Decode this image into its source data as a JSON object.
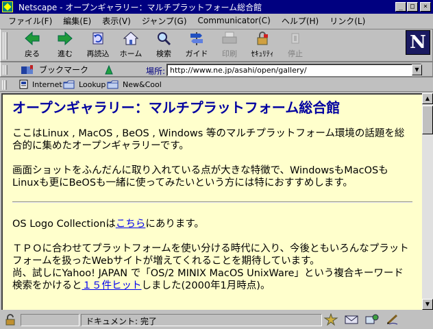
{
  "window": {
    "title": "Netscape - オープンギャラリー：マルチプラットフォーム総合館",
    "minimize": "_",
    "maximize": "□",
    "close": "×"
  },
  "menu": [
    "ファイル(F)",
    "編集(E)",
    "表示(V)",
    "ジャンプ(G)",
    "Communicator(C)",
    "ヘルプ(H)",
    "リンク(L)"
  ],
  "toolbar": {
    "buttons": [
      {
        "label": "戻る",
        "icon": "back-arrow-icon"
      },
      {
        "label": "進む",
        "icon": "forward-arrow-icon"
      },
      {
        "label": "再読込",
        "icon": "reload-icon"
      },
      {
        "label": "ホーム",
        "icon": "home-icon"
      },
      {
        "label": "検索",
        "icon": "search-icon"
      },
      {
        "label": "ガイド",
        "icon": "guide-icon"
      },
      {
        "label": "印刷",
        "icon": "print-icon",
        "disabled": true
      },
      {
        "label": "ｾｷｭﾘﾃｨ",
        "icon": "security-icon"
      },
      {
        "label": "停止",
        "icon": "stop-icon",
        "disabled": true
      }
    ],
    "logo": "N"
  },
  "location": {
    "bookmark_label": "ブックマーク",
    "label": "場所:",
    "url": "http://www.ne.jp/asahi/open/gallery/"
  },
  "personal_toolbar": [
    "Internet",
    "Lookup",
    "New&Cool"
  ],
  "page": {
    "title": "オープンギャラリー：マルチプラットフォーム総合館",
    "intro": "ここはLinux , MacOS , BeOS , Windows 等のマルチプラットフォーム環境の話題を総合的に集めたオープンギャラリーです。",
    "feature": "画面ショットをふんだんに取り入れている点が大きな特徴で、WindowsもMacOSもLinuxも更にBeOSも一緒に使ってみたいという方には特におすすめします。",
    "logo_prefix": "OS Logo Collectionは",
    "logo_link": "こちら",
    "logo_suffix": "にあります。",
    "tpo": "ＴＰＯに合わせてプラットフォームを使い分ける時代に入り、今後ともいろんなプラットフォームを扱ったWebサイトが増えてくれることを期待しています。",
    "search_prefix": "尚、試しにYahoo! JAPAN で「OS/2 MINIX MacOS UnixWare」という複合キーワード検索をかけると",
    "search_link": "１５件ヒット",
    "search_suffix": "しました(2000年1月時点)。"
  },
  "status": {
    "text": "ドキュメント: 完了"
  }
}
